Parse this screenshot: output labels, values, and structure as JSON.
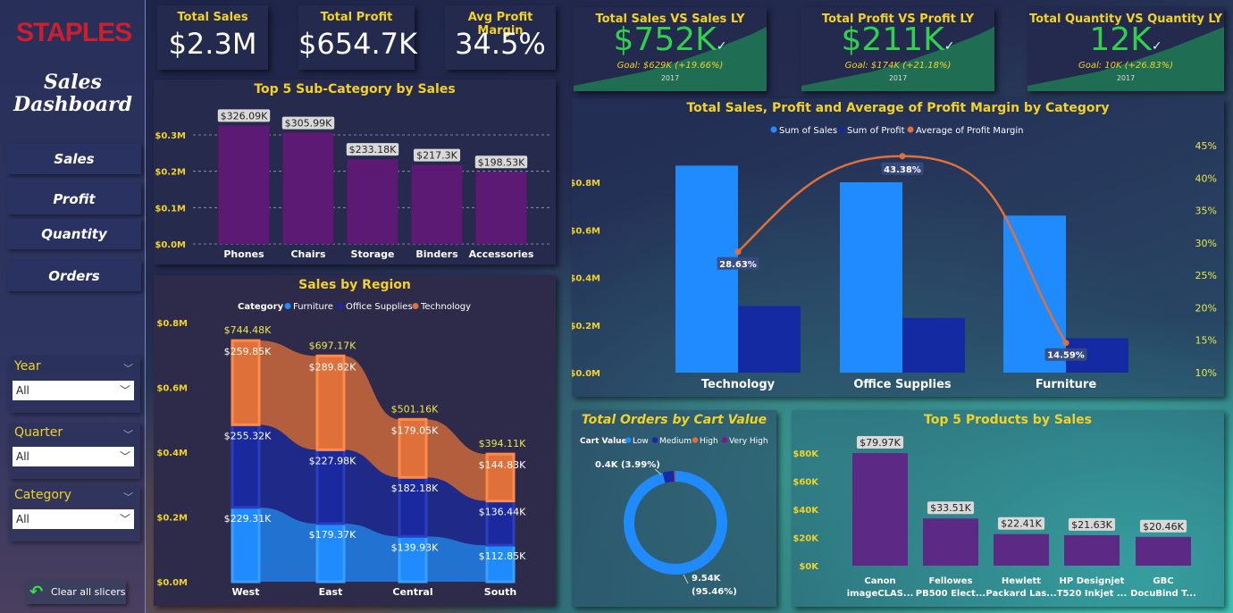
{
  "sidebar": {
    "logo": "STAPLES",
    "title_line1": "Sales",
    "title_line2": "Dashboard",
    "nav": [
      "Sales",
      "Profit",
      "Quantity",
      "Orders"
    ],
    "slicers": [
      {
        "label": "Year",
        "value": "All"
      },
      {
        "label": "Quarter",
        "value": "All"
      },
      {
        "label": "Category",
        "value": "All"
      }
    ],
    "clear_label": "Clear all slicers"
  },
  "kpis": [
    {
      "title": "Total Sales",
      "value": "$2.3M"
    },
    {
      "title": "Total Profit",
      "value": "$654.7K"
    },
    {
      "title": "Avg Profit Margin",
      "value": "34.5%"
    }
  ],
  "kpis_ly": [
    {
      "title": "Total Sales VS Sales LY",
      "value": "$752K",
      "check": "✓",
      "goal": "Goal: $629K (+19.66%)",
      "year": "2017"
    },
    {
      "title": "Total Profit VS Profit LY",
      "value": "$211K",
      "check": "✓",
      "goal": "Goal: $174K (+21.18%)",
      "year": "2017"
    },
    {
      "title": "Total Quantity VS Quantity LY",
      "value": "12K",
      "check": "✓",
      "goal": "Goal: 10K (+26.83%)",
      "year": "2017"
    }
  ],
  "colors": {
    "yellow": "#f2d324",
    "purple": "#5c1a75",
    "furniture": "#1f8bff",
    "office_supplies": "#1a2a9e",
    "technology": "#e0703a",
    "kpi_green": "#2fd14d",
    "sum_sales": "#1f8bff",
    "sum_profit": "#142aa3",
    "margin_line": "#e0703a"
  },
  "chart_data": [
    {
      "id": "subcat",
      "type": "bar",
      "title": "Top 5 Sub-Category by Sales",
      "categories": [
        "Phones",
        "Chairs",
        "Storage",
        "Binders",
        "Accessories"
      ],
      "values": [
        326090,
        305990,
        233180,
        217300,
        198530
      ],
      "labels": [
        "$326.09K",
        "$305.99K",
        "$233.18K",
        "$217.3K",
        "$198.53K"
      ],
      "yticks": [
        "$0.0M",
        "$0.1M",
        "$0.2M",
        "$0.3M"
      ],
      "ylim": [
        0,
        300000
      ]
    },
    {
      "id": "region",
      "type": "bar",
      "title": "Sales by Region",
      "legend_title": "Category",
      "legend": [
        "Furniture",
        "Office Supplies",
        "Technology"
      ],
      "categories": [
        "West",
        "East",
        "Central",
        "South"
      ],
      "series": [
        {
          "name": "Furniture",
          "values": [
            229310,
            179370,
            139930,
            112850
          ],
          "labels": [
            "$229.31K",
            "$179.37K",
            "$139.93K",
            "$112.85K"
          ]
        },
        {
          "name": "Office Supplies",
          "values": [
            255320,
            227980,
            182180,
            136440
          ],
          "labels": [
            "$255.32K",
            "$227.98K",
            "$182.18K",
            "$136.44K"
          ]
        },
        {
          "name": "Technology",
          "values": [
            259850,
            289820,
            179050,
            144830
          ],
          "labels": [
            "$259.85K",
            "$289.82K",
            "$179.05K",
            "$144.83K"
          ]
        }
      ],
      "totals": [
        "$744.48K",
        "$697.17K",
        "$501.16K",
        "$394.11K"
      ],
      "yticks": [
        "$0.0M",
        "$0.2M",
        "$0.4M",
        "$0.6M",
        "$0.8M"
      ],
      "ylim": [
        0,
        800000
      ]
    },
    {
      "id": "category",
      "type": "bar",
      "title": "Total Sales, Profit and Average of Profit Margin by Category",
      "legend": [
        "Sum of Sales",
        "Sum of Profit",
        "Average of Profit Margin"
      ],
      "categories": [
        "Technology",
        "Office Supplies",
        "Furniture"
      ],
      "series": [
        {
          "name": "Sum of Sales",
          "values": [
            870000,
            800000,
            660000
          ]
        },
        {
          "name": "Sum of Profit",
          "values": [
            280000,
            230000,
            145000
          ]
        },
        {
          "name": "Average of Profit Margin",
          "values": [
            28.63,
            43.38,
            14.59
          ],
          "labels": [
            "28.63%",
            "43.38%",
            "14.59%"
          ]
        }
      ],
      "yticks": [
        "$0.0M",
        "$0.2M",
        "$0.4M",
        "$0.6M",
        "$0.8M"
      ],
      "ylim": [
        0,
        950000
      ],
      "y2ticks": [
        "10%",
        "15%",
        "20%",
        "25%",
        "30%",
        "35%",
        "40%",
        "45%"
      ],
      "y2lim": [
        10,
        45
      ]
    },
    {
      "id": "orders",
      "type": "pie",
      "title": "Total Orders by Cart Value",
      "legend_title": "Cart Value",
      "legend": [
        "Low",
        "Medium",
        "High",
        "Very High"
      ],
      "values": [
        9540,
        360,
        25,
        15
      ],
      "labels": [
        "0.4K (3.99%)",
        "9.54K",
        "(95.46%)"
      ]
    },
    {
      "id": "products",
      "type": "bar",
      "title": "Top 5 Products by Sales",
      "categories": [
        [
          "Canon",
          "imageCLAS..."
        ],
        [
          "Fellowes",
          "PB500 Elect..."
        ],
        [
          "Hewlett",
          "Packard Las..."
        ],
        [
          "HP Designjet",
          "T520 Inkjet ..."
        ],
        [
          "GBC",
          "DocuBind T..."
        ]
      ],
      "values": [
        79970,
        33510,
        22410,
        21630,
        20460
      ],
      "labels": [
        "$79.97K",
        "$33.51K",
        "$22.41K",
        "$21.63K",
        "$20.46K"
      ],
      "yticks": [
        "$0K",
        "$20K",
        "$40K",
        "$60K",
        "$80K"
      ],
      "ylim": [
        0,
        80000
      ]
    }
  ]
}
